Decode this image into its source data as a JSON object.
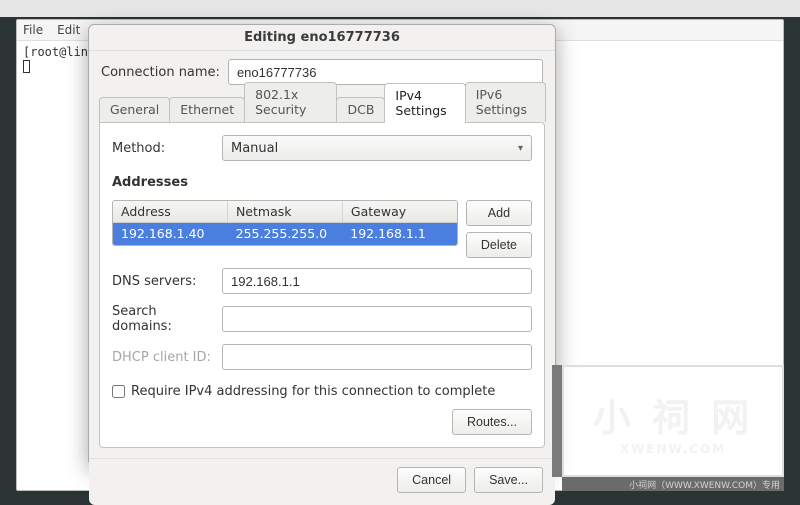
{
  "terminal": {
    "menu_file": "File",
    "menu_edit": "Edit",
    "prompt": "[root@lin"
  },
  "dialog": {
    "title": "Editing eno16777736",
    "conn_label": "Connection name:",
    "conn_value": "eno16777736",
    "tabs": {
      "general": "General",
      "ethernet": "Ethernet",
      "security": "802.1x Security",
      "dcb": "DCB",
      "ipv4": "IPv4 Settings",
      "ipv6": "IPv6 Settings"
    },
    "method_label": "Method:",
    "method_value": "Manual",
    "addresses_title": "Addresses",
    "addr_headers": {
      "address": "Address",
      "netmask": "Netmask",
      "gateway": "Gateway"
    },
    "addr_row": {
      "address": "192.168.1.40",
      "netmask": "255.255.255.0",
      "gateway": "192.168.1.1"
    },
    "btn_add": "Add",
    "btn_delete": "Delete",
    "dns_label": "DNS servers:",
    "dns_value": "192.168.1.1",
    "search_label": "Search domains:",
    "search_value": "",
    "dhcp_label": "DHCP client ID:",
    "dhcp_value": "",
    "require_label": "Require IPv4 addressing for this connection to complete",
    "routes_btn": "Routes...",
    "cancel_btn": "Cancel",
    "save_btn": "Save..."
  },
  "watermark": {
    "big": "小 祠 网",
    "sub": "XWENW.COM",
    "bar": "小祠网（WWW.XWENW.COM）专用"
  }
}
